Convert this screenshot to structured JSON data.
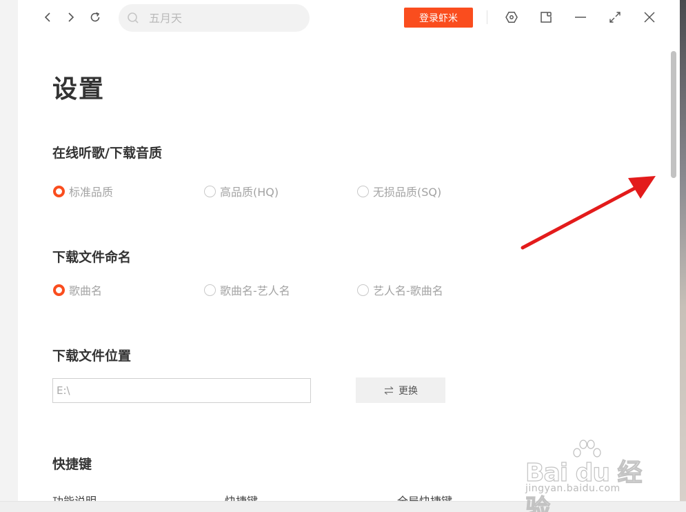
{
  "toolbar": {
    "search_placeholder": "五月天",
    "login_label": "登录虾米"
  },
  "settings": {
    "title": "设置",
    "quality": {
      "title": "在线听歌/下载音质",
      "options": [
        "标准品质",
        "高品质(HQ)",
        "无损品质(SQ)"
      ],
      "selected": 0
    },
    "naming": {
      "title": "下载文件命名",
      "options": [
        "歌曲名",
        "歌曲名-艺人名",
        "艺人名-歌曲名"
      ],
      "selected": 0
    },
    "location": {
      "title": "下载文件位置",
      "path": "E:\\",
      "change_label": "更换"
    },
    "hotkeys": {
      "title": "快捷键",
      "columns": [
        "功能说明",
        "快捷键",
        "全局快捷键"
      ]
    }
  },
  "watermark": {
    "brand": "Bai du 经验",
    "url": "jingyan.baidu.com"
  },
  "colors": {
    "accent": "#fa4d1e",
    "annotation_arrow": "#e31b1b"
  }
}
